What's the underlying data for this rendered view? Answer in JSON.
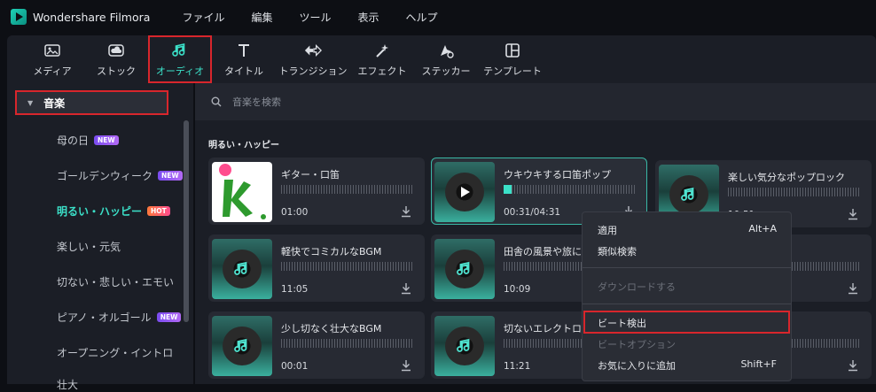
{
  "app": {
    "name": "Wondershare Filmora"
  },
  "menu": [
    "ファイル",
    "編集",
    "ツール",
    "表示",
    "ヘルプ"
  ],
  "toolbar": [
    {
      "label": "メディア",
      "icon": "media-icon"
    },
    {
      "label": "ストック",
      "icon": "stock-icon"
    },
    {
      "label": "オーディオ",
      "icon": "audio-icon",
      "active": true
    },
    {
      "label": "タイトル",
      "icon": "title-icon"
    },
    {
      "label": "トランジション",
      "icon": "transition-icon"
    },
    {
      "label": "エフェクト",
      "icon": "effect-icon"
    },
    {
      "label": "ステッカー",
      "icon": "sticker-icon"
    },
    {
      "label": "テンプレート",
      "icon": "template-icon"
    }
  ],
  "sidebar": {
    "category": "音楽",
    "items": [
      {
        "label": "母の日",
        "badge": "NEW"
      },
      {
        "label": "ゴールデンウィーク",
        "badge": "NEW"
      },
      {
        "label": "明るい・ハッピー",
        "badge": "HOT",
        "selected": true
      },
      {
        "label": "楽しい・元気",
        "badge": ""
      },
      {
        "label": "切ない・悲しい・エモい",
        "badge": ""
      },
      {
        "label": "ピアノ・オルゴール",
        "badge": "NEW"
      },
      {
        "label": "オープニング・イントロ",
        "badge": ""
      },
      {
        "label": "壮大",
        "badge": ""
      }
    ]
  },
  "search": {
    "placeholder": "音楽を検索"
  },
  "section_title": "明るい・ハッピー",
  "cards": [
    {
      "title": "ギター・口笛",
      "duration": "01:00",
      "thumb": "custom"
    },
    {
      "title": "ウキウキする口笛ポップ",
      "duration": "00:31/04:31",
      "selected": true
    },
    {
      "title": "楽しい気分なポップロック",
      "duration": "10:51"
    },
    {
      "title": "軽快でコミカルなBGM",
      "duration": "11:05"
    },
    {
      "title": "田舎の風景や旅に",
      "duration": "10:09"
    },
    {
      "title": "ーミー",
      "duration": ""
    },
    {
      "title": "少し切なく壮大なBGM",
      "duration": "00:01"
    },
    {
      "title": "切ないエレクトロな",
      "duration": "11:21"
    },
    {
      "title": "りを感じる",
      "duration": ""
    }
  ],
  "context_menu": {
    "apply": "適用",
    "apply_key": "Alt+A",
    "similar": "類似検索",
    "download": "ダウンロードする",
    "beat_detect": "ビート検出",
    "beat_option": "ビートオプション",
    "favorite": "お気に入りに追加",
    "favorite_key": "Shift+F"
  },
  "colors": {
    "accent": "#3be0c8",
    "highlight": "#d8262c",
    "new_badge": "#8b5cf6",
    "hot_badge": "#ff5a6e"
  }
}
